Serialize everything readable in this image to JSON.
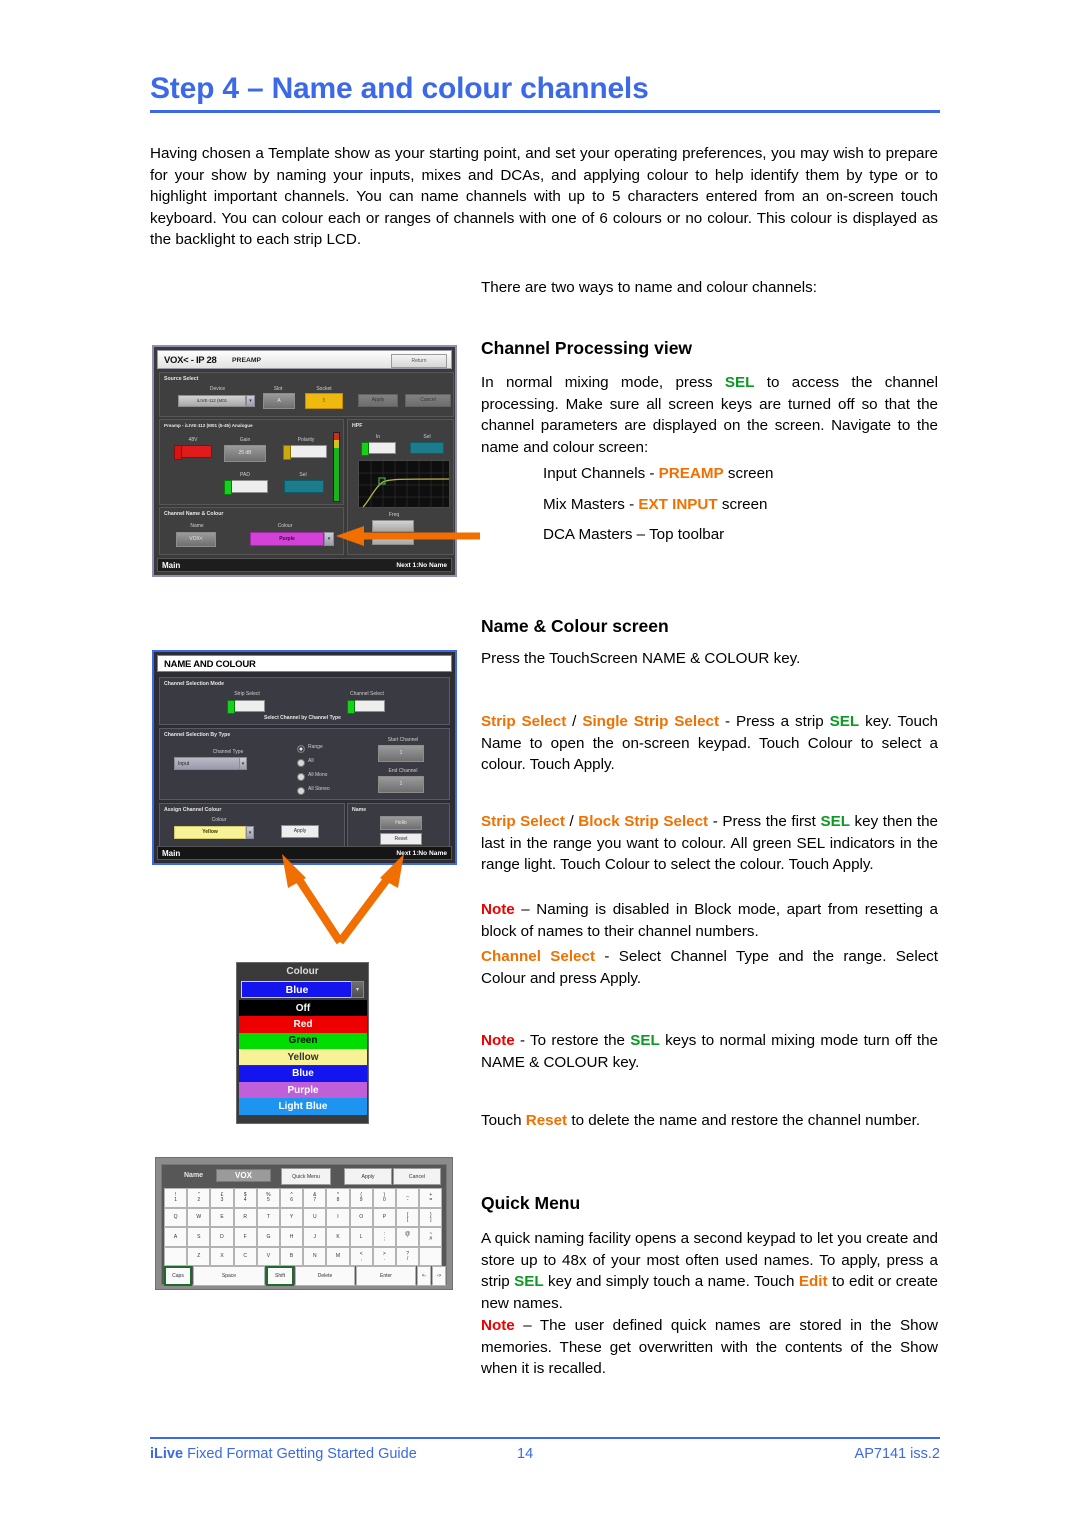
{
  "document": {
    "title": "Step 4 – Name and colour channels",
    "intro": "Having chosen a Template show as your starting point, and set your operating preferences, you may wish to prepare for your show by naming your inputs, mixes and DCAs, and applying colour to help identify them by type or to highlight important channels.  You can name channels with up to 5 characters entered from an on-screen touch keyboard.  You can colour each or ranges of channels with one of 6 colours or no colour. This colour is displayed as the backlight to each strip LCD.",
    "lead": "There are two ways to name and colour channels:"
  },
  "sections": {
    "channel_processing": {
      "heading": "Channel Processing view",
      "body_1": "In normal mixing mode, press ",
      "sel": "SEL",
      "body_2": " to access the channel processing. Make sure all screen keys are turned off so that the channel parameters are displayed on the screen. Navigate to the name and colour screen:",
      "bullets": [
        {
          "pre": "Input Channels - ",
          "hl": "PREAMP",
          "post": " screen"
        },
        {
          "pre": "Mix Masters - ",
          "hl": "EXT INPUT",
          "post": " screen"
        },
        {
          "pre": "DCA Masters – Top toolbar",
          "hl": "",
          "post": ""
        }
      ]
    },
    "name_colour": {
      "heading": "Name & Colour screen",
      "intro": "Press the TouchScreen NAME & COLOUR key.",
      "single": {
        "label_a": "Strip Select",
        "sep": " / ",
        "label_b": "Single Strip Select",
        "body_1": " - Press a strip ",
        "sel": "SEL",
        "body_2": " key. Touch Name to open the on-screen keypad. Touch Colour to select a colour. Touch Apply."
      },
      "block": {
        "label_a": "Strip Select",
        "sep": " / ",
        "label_b": "Block Strip Select",
        "body_1": " - Press the first ",
        "sel": "SEL",
        "body_2": " key then the last in the range you want to colour. All green SEL indicators in the range light. Touch Colour to select the colour. Touch Apply."
      },
      "note_block": {
        "label": "Note",
        "text": " – Naming is disabled in Block mode, apart from resetting a block of names to their channel numbers."
      },
      "channel_select": {
        "label": "Channel Select",
        "text": " - Select Channel Type and the range. Select Colour and press Apply."
      },
      "note_restore": {
        "label": "Note",
        "text_1": " - To restore the ",
        "sel": "SEL",
        "text_2": " keys to normal mixing mode turn off the NAME & COLOUR key."
      },
      "reset_line": {
        "pre": "Touch ",
        "hl": "Reset",
        "post": " to delete the name and restore the channel number."
      }
    },
    "quick_menu": {
      "heading": "Quick Menu",
      "body_1": "A quick naming facility opens a second keypad to let you create and store up to 48x of your most often used names. To apply, press a strip ",
      "sel": "SEL",
      "body_2": " key and simply touch a name. Touch ",
      "edit": "Edit",
      "body_3": " to edit or create new names.",
      "note": {
        "label": "Note",
        "text": " – The user defined quick names are stored in the Show memories.  These get overwritten with the contents of the Show when it is recalled."
      }
    }
  },
  "footer": {
    "brand": "iLive",
    "left": " Fixed Format   Getting Started Guide",
    "page": "14",
    "right": "AP7141 iss.2"
  },
  "screenshots": {
    "preamp": {
      "title_channel": "VOX< - IP 28",
      "title_screen": "PREAMP",
      "return": "Return",
      "source_select": "Source Select",
      "device_label": "Device",
      "device_value": "iLIVE-112 (M01",
      "slot_label": "Slot",
      "slot_value": "A",
      "socket_label": "Socket",
      "socket_value": "5",
      "apply": "Apply",
      "cancel": "Cancel",
      "preamp_header": "Preamp - iLIVE-112 (M01 (5-45) Analogue",
      "phantom": "48V",
      "gain_label": "Gain",
      "gain_value": "25 dB",
      "polarity": "Polarity",
      "pad": "PAD",
      "sel": "Sel",
      "hpf": "HPF",
      "hpf_in": "In",
      "hpf_sel": "Sel",
      "freq_label": "Freq",
      "name_colour_header": "Channel Name & Colour",
      "name_label": "Name",
      "name_value": "VOX<",
      "colour_label": "Colour",
      "colour_value": "Purple",
      "status_left": "Main",
      "status_right": "Next 1:No Name"
    },
    "namecolour": {
      "title": "NAME AND COLOUR",
      "mode_header": "Channel Selection Mode",
      "strip_select": "Strip Select",
      "channel_select": "Channel Select",
      "select_by_type_note": "Select Channel by Channel Type",
      "type_header": "Channel Selection By Type",
      "channel_type_label": "Channel Type",
      "channel_type_value": "Input",
      "radios": [
        "Range",
        "All",
        "All Mono",
        "All Stereo"
      ],
      "start_channel_label": "Start Channel",
      "start_channel_value": "1",
      "end_channel_label": "End Channel",
      "end_channel_value": "1",
      "assign_header": "Assign Channel Colour",
      "colour_label": "Colour",
      "colour_value": "Yellow",
      "apply": "Apply",
      "name_header": "Name",
      "name_btn": "Hello",
      "reset_btn": "Reset",
      "status_left": "Main",
      "status_right": "Next 1:No Name"
    },
    "colour_list": {
      "header": "Colour",
      "selected": {
        "label": "Blue",
        "bg": "#1414ee",
        "fg": "#ffffff"
      },
      "items": [
        {
          "label": "Off",
          "bg": "#000000",
          "fg": "#ffffff"
        },
        {
          "label": "Red",
          "bg": "#ee0000",
          "fg": "#ffffff"
        },
        {
          "label": "Green",
          "bg": "#00dd00",
          "fg": "#000000"
        },
        {
          "label": "Yellow",
          "bg": "#f7f295",
          "fg": "#333333"
        },
        {
          "label": "Blue",
          "bg": "#1414ee",
          "fg": "#ffffff"
        },
        {
          "label": "Purple",
          "bg": "#c060d8",
          "fg": "#ffffff"
        },
        {
          "label": "Light Blue",
          "bg": "#1d95f0",
          "fg": "#ffffff"
        }
      ]
    },
    "keyboard": {
      "name_label": "Name",
      "name_value": "VOX",
      "quick_menu": "Quick Menu",
      "apply": "Apply",
      "cancel": "Cancel",
      "row1": [
        "!|1",
        "\"|2",
        "£|3",
        "$|4",
        "%|5",
        "^|6",
        "&|7",
        "*|8",
        "(|9",
        ")|0",
        "_|-",
        "+|="
      ],
      "row2": [
        "Q",
        "W",
        "E",
        "R",
        "T",
        "Y",
        "U",
        "I",
        "O",
        "P",
        "{|[",
        "}|]"
      ],
      "row3": [
        "A",
        "S",
        "D",
        "F",
        "G",
        "H",
        "J",
        "K",
        "L",
        ":|;",
        "@|'",
        "~|#"
      ],
      "row4": [
        "||\\",
        "Z",
        "X",
        "C",
        "V",
        "B",
        "N",
        "M",
        "<|,",
        ">|.",
        "?|/",
        ""
      ],
      "bottom": [
        "Caps",
        "Space",
        "Shift",
        "Delete",
        "Enter",
        "<-",
        "->"
      ]
    }
  },
  "colors": {
    "accent_blue": "#3b69e8",
    "orange": "#f07000",
    "green": "#0b9a22",
    "red": "#ee0000"
  }
}
